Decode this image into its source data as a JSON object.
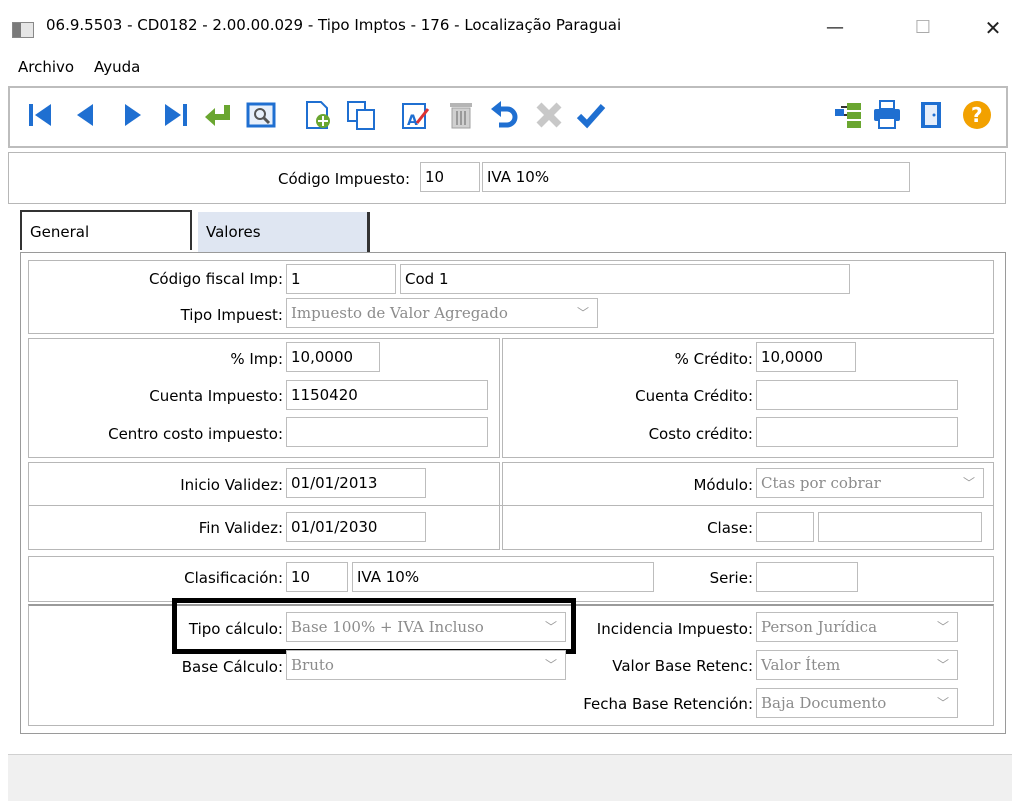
{
  "window": {
    "title": "06.9.5503 - CD0182 - 2.00.00.029 - Tipo Imptos - 176 - Localização Paraguai",
    "minimize": "—",
    "maximize": "☐",
    "close": "✕"
  },
  "menu": {
    "archivo": "Archivo",
    "ayuda": "Ayuda"
  },
  "toolbar": {
    "icons": [
      "first-record-icon",
      "previous-record-icon",
      "next-record-icon",
      "last-record-icon",
      "return-icon",
      "preview-icon",
      "new-record-icon",
      "copy-record-icon",
      "edit-record-icon",
      "delete-record-icon",
      "undo-icon",
      "cancel-icon",
      "confirm-icon",
      "hierarchy-icon",
      "print-icon",
      "exit-icon",
      "help-icon"
    ]
  },
  "header": {
    "codigo_label": "Código Impuesto:",
    "codigo_value": "10",
    "descripcion_value": "IVA 10%"
  },
  "tabs": {
    "general": "General",
    "valores": "Valores"
  },
  "general": {
    "codigo_fiscal_label": "Código fiscal Imp:",
    "codigo_fiscal_value": "1",
    "codigo_fiscal_desc": "Cod 1",
    "tipo_impuest_label": "Tipo Impuest:",
    "tipo_impuest_value": "Impuesto de Valor Agregado",
    "pct_imp_label": "% Imp:",
    "pct_imp_value": "10,0000",
    "cuenta_impuesto_label": "Cuenta Impuesto:",
    "cuenta_impuesto_value": "1150420",
    "centro_costo_label": "Centro costo impuesto:",
    "centro_costo_value": "",
    "pct_credito_label": "% Crédito:",
    "pct_credito_value": "10,0000",
    "cuenta_credito_label": "Cuenta Crédito:",
    "cuenta_credito_value": "",
    "costo_credito_label": "Costo crédito:",
    "costo_credito_value": "",
    "inicio_validez_label": "Inicio Validez:",
    "inicio_validez_value": "01/01/2013",
    "modulo_label": "Módulo:",
    "modulo_value": "Ctas por cobrar",
    "fin_validez_label": "Fin Validez:",
    "fin_validez_value": "01/01/2030",
    "clase_label": "Clase:",
    "clase_value": "",
    "clase_desc": "",
    "clasificacion_label": "Clasificación:",
    "clasificacion_value": "10",
    "clasificacion_desc": "IVA 10%",
    "serie_label": "Serie:",
    "serie_value": "",
    "tipo_calculo_label": "Tipo cálculo:",
    "tipo_calculo_value": "Base 100% + IVA Incluso",
    "base_calculo_label": "Base Cálculo:",
    "base_calculo_value": "Bruto",
    "incidencia_label": "Incidencia Impuesto:",
    "incidencia_value": "Person Jurídica",
    "valor_base_label": "Valor Base Retenc:",
    "valor_base_value": "Valor Ítem",
    "fecha_base_label": "Fecha Base Retención:",
    "fecha_base_value": "Baja Documento"
  },
  "colors": {
    "icon_blue": "#1f6fd1",
    "icon_green": "#6aa630",
    "help_orange": "#f2a100",
    "highlight_box": "#000000"
  }
}
